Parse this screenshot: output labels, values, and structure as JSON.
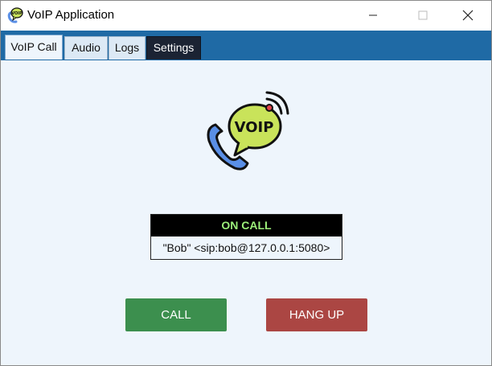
{
  "window": {
    "title": "VoIP Application",
    "minimize_icon": "minimize-icon",
    "maximize_icon": "maximize-icon",
    "close_icon": "close-icon"
  },
  "tabs": [
    {
      "label": "VoIP Call",
      "active": true
    },
    {
      "label": "Audio",
      "active": false
    },
    {
      "label": "Logs",
      "active": false
    },
    {
      "label": "Settings",
      "active": false
    }
  ],
  "logo": {
    "text": "VOIP"
  },
  "status": {
    "header": "ON CALL",
    "contact": "\"Bob\" <sip:bob@127.0.0.1:5080>"
  },
  "buttons": {
    "call": "CALL",
    "hangup": "HANG UP"
  },
  "colors": {
    "tabbar": "#1f6aa5",
    "content_bg": "#eef5fc",
    "status_text": "#9cf07a",
    "call_button": "#3c8f4e",
    "hangup_button": "#ab4643",
    "logo_bubble": "#c9e35a",
    "logo_phone": "#5a8fe6"
  }
}
